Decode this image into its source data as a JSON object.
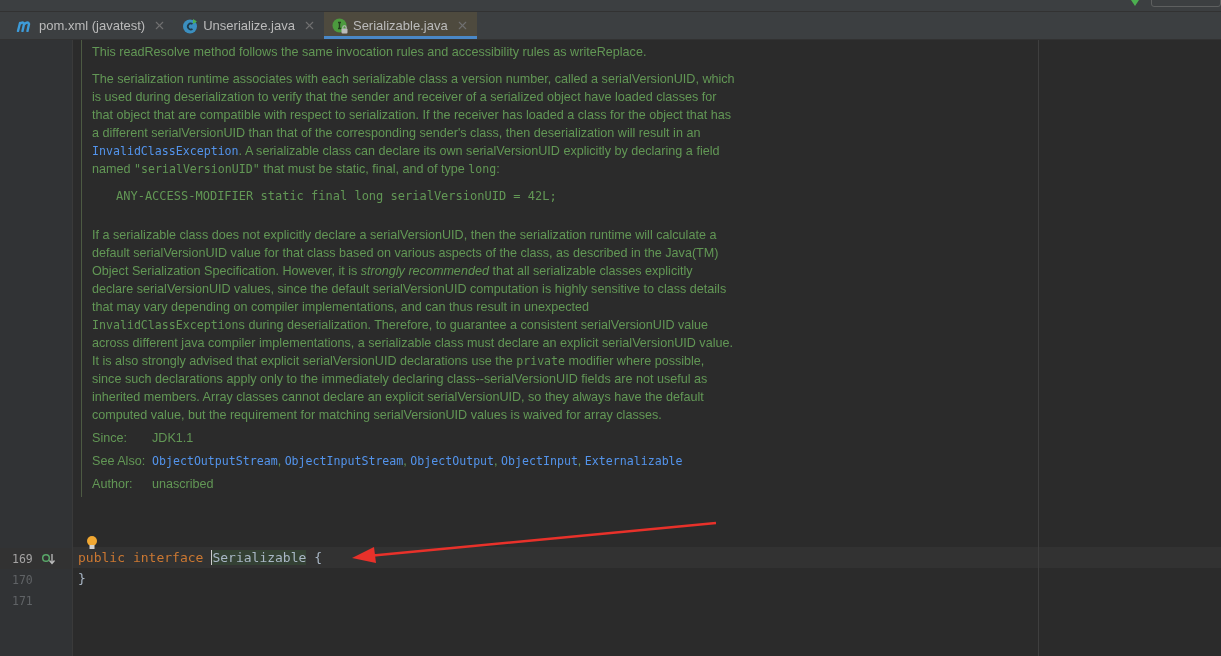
{
  "tabs": [
    {
      "label": "pom.xml (javatest)",
      "kind": "maven",
      "selected": false
    },
    {
      "label": "Unserialize.java",
      "kind": "class",
      "selected": false
    },
    {
      "label": "Serializable.java",
      "kind": "interface",
      "selected": true
    }
  ],
  "doc": {
    "paragraphs": [
      [
        {
          "kind": "text",
          "text": "This readResolve method follows the same invocation rules and accessibility rules as writeReplace."
        }
      ],
      [
        {
          "kind": "text",
          "text": "The serialization runtime associates with each serializable class a version number, called a serialVersionUID, which is used during deserialization to verify that the sender and receiver of a serialized object have loaded classes for that object that are compatible with respect to serialization. If the receiver has loaded a class for the object that has a different serialVersionUID than that of the corresponding sender's class, then deserialization will result in an "
        },
        {
          "kind": "link",
          "text": "InvalidClassException"
        },
        {
          "kind": "text",
          "text": ". A serializable class can declare its own serialVersionUID explicitly by declaring a field named "
        },
        {
          "kind": "code",
          "text": "\"serialVersionUID\""
        },
        {
          "kind": "text",
          "text": " that must be static, final, and of type "
        },
        {
          "kind": "code",
          "text": "long"
        },
        {
          "kind": "text",
          "text": ":"
        }
      ],
      [
        {
          "kind": "pre",
          "text": "ANY-ACCESS-MODIFIER static final long serialVersionUID = 42L;"
        }
      ],
      [
        {
          "kind": "text",
          "text": "If a serializable class does not explicitly declare a serialVersionUID, then the serialization runtime will calculate a default serialVersionUID value for that class based on various aspects of the class, as described in the Java(TM) Object Serialization Specification. However, it is "
        },
        {
          "kind": "em",
          "text": "strongly recommended"
        },
        {
          "kind": "text",
          "text": " that all serializable classes explicitly declare serialVersionUID values, since the default serialVersionUID computation is highly sensitive to class details that may vary depending on compiler implementations, and can thus result in unexpected "
        },
        {
          "kind": "code",
          "text": "InvalidClassException"
        },
        {
          "kind": "text",
          "text": "s during deserialization. Therefore, to guarantee a consistent serialVersionUID value across different java compiler implementations, a serializable class must declare an explicit serialVersionUID value. It is also strongly advised that explicit serialVersionUID declarations use the "
        },
        {
          "kind": "code",
          "text": "private"
        },
        {
          "kind": "text",
          "text": " modifier where possible, since such declarations apply only to the immediately declaring class--serialVersionUID fields are not useful as inherited members. Array classes cannot declare an explicit serialVersionUID, so they always have the default computed value, but the requirement for matching serialVersionUID values is waived for array classes."
        }
      ]
    ],
    "tags": [
      {
        "label": "Since:",
        "values": [
          {
            "kind": "text",
            "text": "JDK1.1"
          }
        ]
      },
      {
        "label": "See Also:",
        "separator": ",",
        "values": [
          {
            "kind": "link",
            "text": "ObjectOutputStream"
          },
          {
            "kind": "link",
            "text": "ObjectInputStream"
          },
          {
            "kind": "link",
            "text": "ObjectOutput"
          },
          {
            "kind": "link",
            "text": "ObjectInput"
          },
          {
            "kind": "link",
            "text": "Externalizable"
          }
        ]
      },
      {
        "label": "Author:",
        "values": [
          {
            "kind": "text",
            "text": "unascribed"
          }
        ]
      }
    ]
  },
  "code_lines": [
    {
      "number": "169",
      "current": true,
      "implemented": true,
      "tokens": [
        {
          "kind": "keyword",
          "text": "public"
        },
        {
          "kind": "keyword",
          "text": "interface"
        },
        {
          "kind": "name",
          "text": "Serializable",
          "cursor": true
        },
        {
          "kind": "punct",
          "text": "{"
        }
      ]
    },
    {
      "number": "170",
      "current": false,
      "implemented": false,
      "tokens": [
        {
          "kind": "punct",
          "text": "}"
        }
      ]
    },
    {
      "number": "171",
      "current": false,
      "implemented": false
    }
  ]
}
